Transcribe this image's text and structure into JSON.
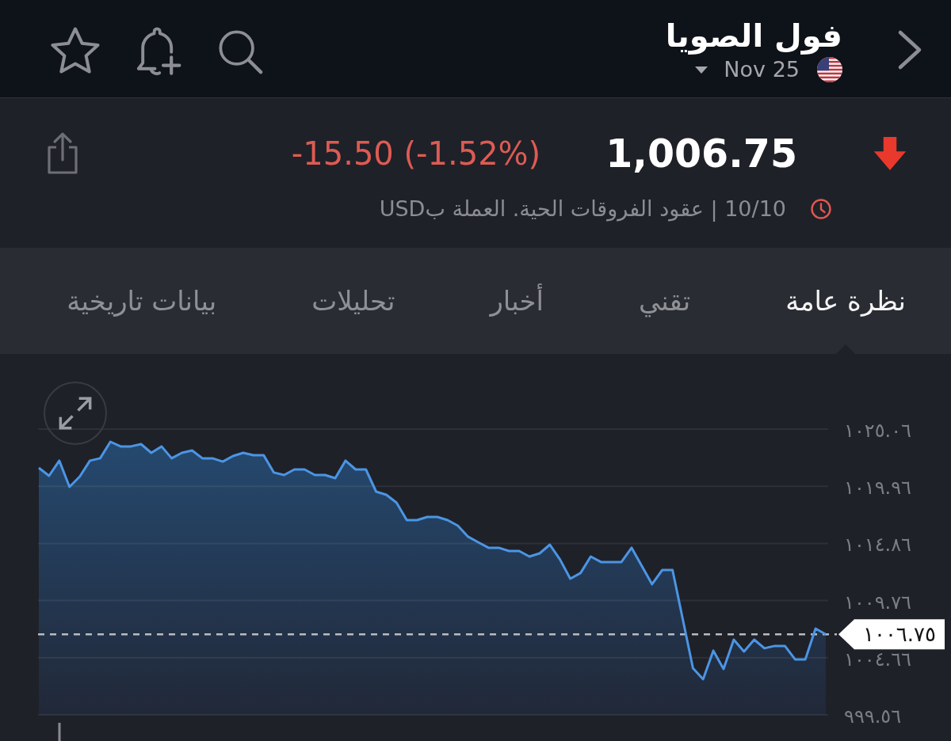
{
  "header": {
    "title": "فول الصويا",
    "contract": "Nov 25"
  },
  "quote": {
    "price": "1,006.75",
    "change": "-15.50 (-1.52%)",
    "negative": true,
    "info": "10/10 | عقود الفروقات الحية. العملة بUSD"
  },
  "tabs": [
    {
      "label": "نظرة عامة",
      "selected": true
    },
    {
      "label": "تقني",
      "selected": false
    },
    {
      "label": "أخبار",
      "selected": false
    },
    {
      "label": "تحليلات",
      "selected": false
    },
    {
      "label": "بيانات تاريخية",
      "selected": false
    }
  ],
  "chart": {
    "chart_data": {
      "type": "area",
      "grid": true,
      "ylim": [
        999.56,
        1025.06
      ],
      "yticks": [
        {
          "value": 1025.06,
          "label": "١٠٢٥.٠٦"
        },
        {
          "value": 1019.96,
          "label": "١٠١٩.٩٦"
        },
        {
          "value": 1014.86,
          "label": "١٠١٤.٨٦"
        },
        {
          "value": 1009.76,
          "label": "١٠٠٩.٧٦"
        },
        {
          "value": 1004.66,
          "label": "١٠٠٤.٦٦"
        },
        {
          "value": 999.56,
          "label": "٩٩٩.٥٦"
        }
      ],
      "values": [
        1021.6,
        1020.89,
        1022.24,
        1019.9,
        1020.82,
        1022.24,
        1022.45,
        1023.93,
        1023.51,
        1023.51,
        1023.72,
        1022.94,
        1023.51,
        1022.45,
        1022.94,
        1023.15,
        1022.45,
        1022.45,
        1022.16,
        1022.66,
        1022.94,
        1022.73,
        1022.73,
        1021.18,
        1020.96,
        1021.46,
        1021.46,
        1020.96,
        1020.96,
        1020.68,
        1022.24,
        1021.46,
        1021.46,
        1019.48,
        1019.2,
        1018.49,
        1016.94,
        1016.94,
        1017.22,
        1017.22,
        1016.94,
        1016.44,
        1015.46,
        1014.96,
        1014.47,
        1014.47,
        1014.18,
        1014.18,
        1013.69,
        1013.97,
        1014.75,
        1013.41,
        1011.71,
        1012.21,
        1013.69,
        1013.2,
        1013.2,
        1013.2,
        1014.47,
        1012.84,
        1011.22,
        1012.49,
        1012.49,
        1008.11,
        1003.73,
        1002.74,
        1005.29,
        1003.66,
        1006.27,
        1005.22,
        1006.27,
        1005.5,
        1005.71,
        1005.71,
        1004.51,
        1004.51,
        1007.26,
        1006.75
      ],
      "ref_lines": [
        {
          "axis": "y",
          "value": 1006.75,
          "label": "١٠٠٦.٧٥"
        }
      ]
    }
  }
}
